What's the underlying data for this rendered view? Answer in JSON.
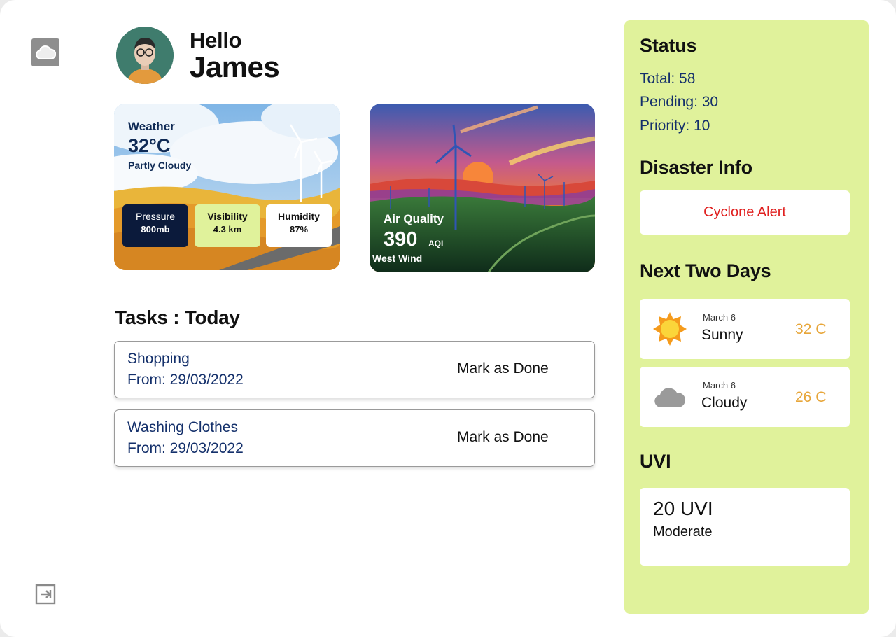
{
  "sidebar": {
    "items": [
      {
        "icon": "cloud-icon",
        "label": "Weather"
      },
      {
        "icon": "logout-icon",
        "label": "Logout"
      }
    ]
  },
  "user": {
    "greeting": "Hello",
    "name": "James"
  },
  "weather": {
    "title": "Weather",
    "temperature": "32°C",
    "condition": "Partly Cloudy",
    "pressure": {
      "label": "Pressure",
      "value": "800mb"
    },
    "visibility": {
      "label": "Visibility",
      "value": "4.3 km"
    },
    "humidity": {
      "label": "Humidity",
      "value": "87%"
    }
  },
  "air_quality": {
    "title": "Air Quality",
    "value": "390",
    "unit": "AQI",
    "wind": "West Wind"
  },
  "tasks": {
    "title": "Tasks : Today",
    "items": [
      {
        "name": "Shopping",
        "from": "From: 29/03/2022",
        "action": "Mark as Done"
      },
      {
        "name": "Washing Clothes",
        "from": "From: 29/03/2022",
        "action": "Mark as Done"
      }
    ]
  },
  "panel": {
    "status": {
      "title": "Status",
      "total": "Total: 58",
      "pending": "Pending: 30",
      "priority": "Priority: 10"
    },
    "disaster": {
      "title": "Disaster Info",
      "alert": "Cyclone Alert"
    },
    "forecast": {
      "title": "Next Two Days",
      "days": [
        {
          "date": "March 6",
          "condition": "Sunny",
          "temp": "32 C",
          "icon": "sun-icon"
        },
        {
          "date": "March 6",
          "condition": "Cloudy",
          "temp": "26 C",
          "icon": "cloud-icon"
        }
      ]
    },
    "uvi": {
      "title": "UVI",
      "value": "20 UVI",
      "level": "Moderate"
    }
  },
  "colors": {
    "panel_bg": "#e0f29b",
    "alert": "#e0201f",
    "forecast_temp": "#e7a63a",
    "text_blue": "#14306b"
  }
}
